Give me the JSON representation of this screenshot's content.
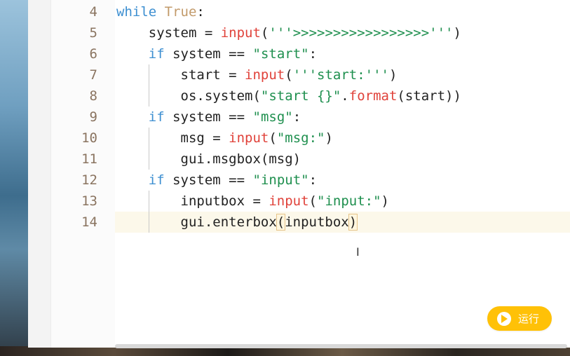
{
  "editor": {
    "lines": [
      {
        "number": "4",
        "segments": [
          {
            "t": "while",
            "c": "kw"
          },
          {
            "t": " ",
            "c": ""
          },
          {
            "t": "True",
            "c": "tr"
          },
          {
            "t": ":",
            "c": ""
          }
        ]
      },
      {
        "number": "5",
        "segments": [
          {
            "t": "    system = ",
            "c": ""
          },
          {
            "t": "input",
            "c": "fn"
          },
          {
            "t": "(",
            "c": ""
          },
          {
            "t": "'''>>>>>>>>>>>>>>>>>'''",
            "c": "str"
          },
          {
            "t": ")",
            "c": ""
          }
        ]
      },
      {
        "number": "6",
        "segments": [
          {
            "t": "    ",
            "c": ""
          },
          {
            "t": "if",
            "c": "kw"
          },
          {
            "t": " system == ",
            "c": ""
          },
          {
            "t": "\"start\"",
            "c": "str"
          },
          {
            "t": ":",
            "c": ""
          }
        ]
      },
      {
        "number": "7",
        "segments": [
          {
            "t": "        start = ",
            "c": ""
          },
          {
            "t": "input",
            "c": "fn"
          },
          {
            "t": "(",
            "c": ""
          },
          {
            "t": "'''start:'''",
            "c": "str"
          },
          {
            "t": ")",
            "c": ""
          }
        ]
      },
      {
        "number": "8",
        "segments": [
          {
            "t": "        os.system(",
            "c": ""
          },
          {
            "t": "\"start {}\"",
            "c": "str"
          },
          {
            "t": ".",
            "c": ""
          },
          {
            "t": "format",
            "c": "fn"
          },
          {
            "t": "(start))",
            "c": ""
          }
        ]
      },
      {
        "number": "9",
        "segments": [
          {
            "t": "    ",
            "c": ""
          },
          {
            "t": "if",
            "c": "kw"
          },
          {
            "t": " system == ",
            "c": ""
          },
          {
            "t": "\"msg\"",
            "c": "str"
          },
          {
            "t": ":",
            "c": ""
          }
        ]
      },
      {
        "number": "10",
        "segments": [
          {
            "t": "        msg = ",
            "c": ""
          },
          {
            "t": "input",
            "c": "fn"
          },
          {
            "t": "(",
            "c": ""
          },
          {
            "t": "\"msg:\"",
            "c": "str"
          },
          {
            "t": ")",
            "c": ""
          }
        ]
      },
      {
        "number": "11",
        "segments": [
          {
            "t": "        gui.msgbox(msg)",
            "c": ""
          }
        ]
      },
      {
        "number": "12",
        "segments": [
          {
            "t": "    ",
            "c": ""
          },
          {
            "t": "if",
            "c": "kw"
          },
          {
            "t": " system == ",
            "c": ""
          },
          {
            "t": "\"input\"",
            "c": "str"
          },
          {
            "t": ":",
            "c": ""
          }
        ]
      },
      {
        "number": "13",
        "segments": [
          {
            "t": "        inputbox = ",
            "c": ""
          },
          {
            "t": "input",
            "c": "fn"
          },
          {
            "t": "(",
            "c": ""
          },
          {
            "t": "\"input:\"",
            "c": "str"
          },
          {
            "t": ")",
            "c": ""
          }
        ]
      },
      {
        "number": "14",
        "segments": [
          {
            "t": "        gui.enterbox",
            "c": ""
          },
          {
            "t": "(",
            "c": "bracket"
          },
          {
            "t": "inputbox",
            "c": ""
          },
          {
            "t": ")",
            "c": "bracket"
          }
        ]
      }
    ]
  },
  "run_button": {
    "label": "运行",
    "icon": "play-icon"
  },
  "colors": {
    "accent": "#ffc107",
    "keyword": "#3d8fd1",
    "function": "#e0423a",
    "string": "#1e8f4e",
    "line_number": "#8a7460"
  }
}
